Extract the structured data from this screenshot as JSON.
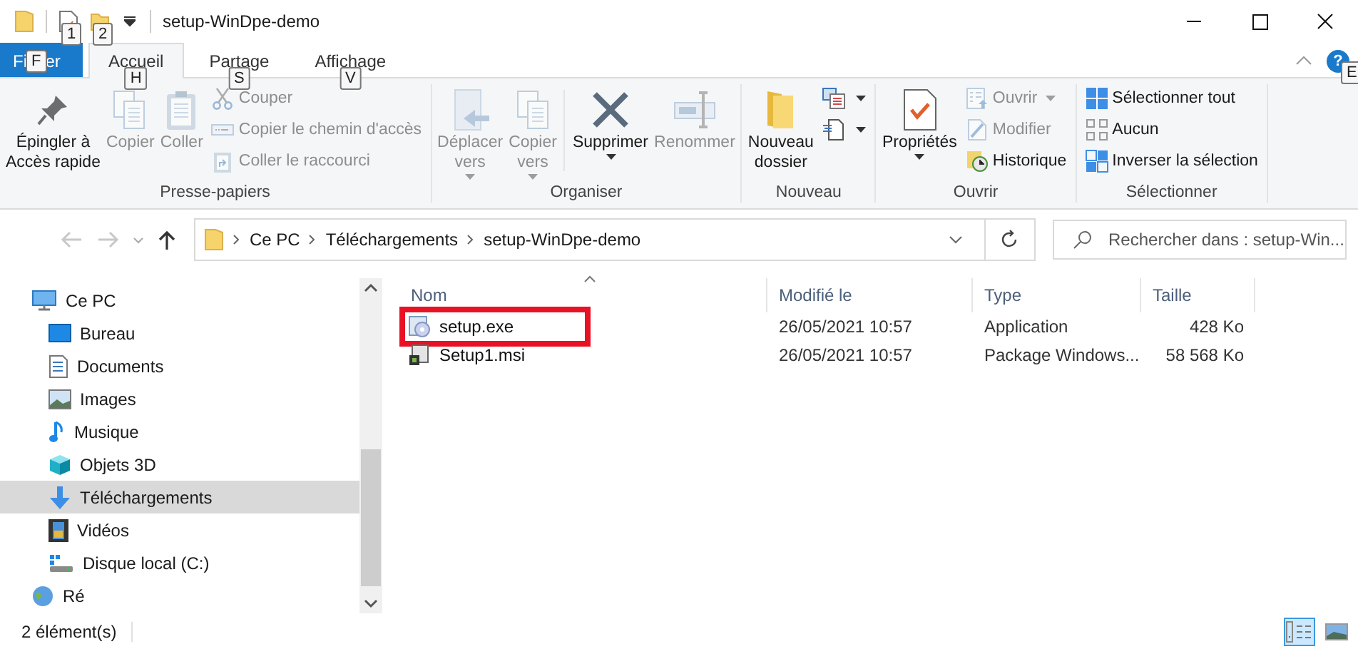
{
  "window": {
    "title": "setup-WinDpe-demo",
    "quick_access_keytips": [
      "1",
      "2"
    ]
  },
  "ribbon": {
    "tabs": [
      {
        "kind": "file",
        "label_start": "Fi",
        "label_end": "er",
        "keytip": "F",
        "selected": false
      },
      {
        "kind": "tab",
        "label": "Accueil",
        "keytip": "H",
        "selected": true
      },
      {
        "kind": "tab",
        "label": "Partage",
        "keytip": "S",
        "selected": false
      },
      {
        "kind": "tab",
        "label": "Affichage",
        "keytip": "V",
        "selected": false
      }
    ],
    "help": {
      "glyph": "?",
      "keytip": "E"
    },
    "groups": [
      {
        "label": "Presse-papiers",
        "items": [
          {
            "kind": "large",
            "label": "Épingler à\nAccès rapide",
            "disabled": false,
            "has_menu": false
          },
          {
            "kind": "large",
            "label": "Copier",
            "disabled": true,
            "has_menu": false
          },
          {
            "kind": "large",
            "label": "Coller",
            "disabled": true,
            "has_menu": false
          },
          {
            "kind": "column",
            "items": [
              {
                "label": "Couper",
                "disabled": true,
                "has_menu": false
              },
              {
                "label": "Copier le chemin d'accès",
                "disabled": true,
                "has_menu": false
              },
              {
                "label": "Coller le raccourci",
                "disabled": true,
                "has_menu": false
              }
            ]
          }
        ]
      },
      {
        "label": "Organiser",
        "items": [
          {
            "kind": "large",
            "label": "Déplacer\nvers",
            "disabled": true,
            "has_menu": true
          },
          {
            "kind": "large",
            "label": "Copier\nvers",
            "disabled": true,
            "has_menu": true
          },
          {
            "kind": "separator"
          },
          {
            "kind": "large",
            "label": "Supprimer",
            "disabled": false,
            "has_menu": true
          },
          {
            "kind": "large",
            "label": "Renommer",
            "disabled": true,
            "has_menu": false
          }
        ]
      },
      {
        "label": "Nouveau",
        "items": [
          {
            "kind": "large",
            "label": "Nouveau\ndossier",
            "disabled": false,
            "has_menu": false
          },
          {
            "kind": "column",
            "items": [
              {
                "disabled": false,
                "has_menu": true
              },
              {
                "disabled": false,
                "has_menu": true
              }
            ]
          }
        ]
      },
      {
        "label": "Ouvrir",
        "items": [
          {
            "kind": "large",
            "label": "Propriétés",
            "disabled": false,
            "has_menu": true
          },
          {
            "kind": "column",
            "items": [
              {
                "label": "Ouvrir",
                "disabled": true,
                "has_menu": true
              },
              {
                "label": "Modifier",
                "disabled": true,
                "has_menu": false
              },
              {
                "label": "Historique",
                "disabled": false,
                "has_menu": false
              }
            ]
          }
        ]
      },
      {
        "label": "Sélectionner",
        "items": [
          {
            "kind": "column",
            "items": [
              {
                "label": "Sélectionner tout",
                "disabled": false,
                "has_menu": false
              },
              {
                "label": "Aucun",
                "disabled": false,
                "has_menu": false
              },
              {
                "label": "Inverser la sélection",
                "disabled": false,
                "has_menu": false
              }
            ]
          }
        ]
      }
    ]
  },
  "address_bar": {
    "back_disabled": true,
    "forward_disabled": true,
    "breadcrumbs": [
      "Ce PC",
      "Téléchargements",
      "setup-WinDpe-demo"
    ],
    "search_placeholder": "Rechercher dans : setup-Win..."
  },
  "sidebar": {
    "items": [
      {
        "label": "Ce PC",
        "selected": false,
        "children": [
          {
            "label": "Bureau",
            "selected": false
          },
          {
            "label": "Documents",
            "selected": false
          },
          {
            "label": "Images",
            "selected": false
          },
          {
            "label": "Musique",
            "selected": false
          },
          {
            "label": "Objets 3D",
            "selected": false
          },
          {
            "label": "Téléchargements",
            "selected": true
          },
          {
            "label": "Vidéos",
            "selected": false
          },
          {
            "label": "Disque local (C:)",
            "selected": false
          }
        ]
      },
      {
        "label": "Ré",
        "selected": false
      }
    ]
  },
  "file_list": {
    "columns": [
      "Nom",
      "Modifié le",
      "Type",
      "Taille"
    ],
    "rows": [
      {
        "name": "setup.exe",
        "modified": "26/05/2021 10:57",
        "type": "Application",
        "size": "428 Ko",
        "outlined": true
      },
      {
        "name": "Setup1.msi",
        "modified": "26/05/2021 10:57",
        "type": "Package Windows...",
        "size": "58 568 Ko",
        "outlined": false
      }
    ]
  },
  "status_bar": {
    "text": "2 élément(s)",
    "view_buttons": [
      {
        "selected": true
      },
      {
        "selected": false
      }
    ]
  }
}
